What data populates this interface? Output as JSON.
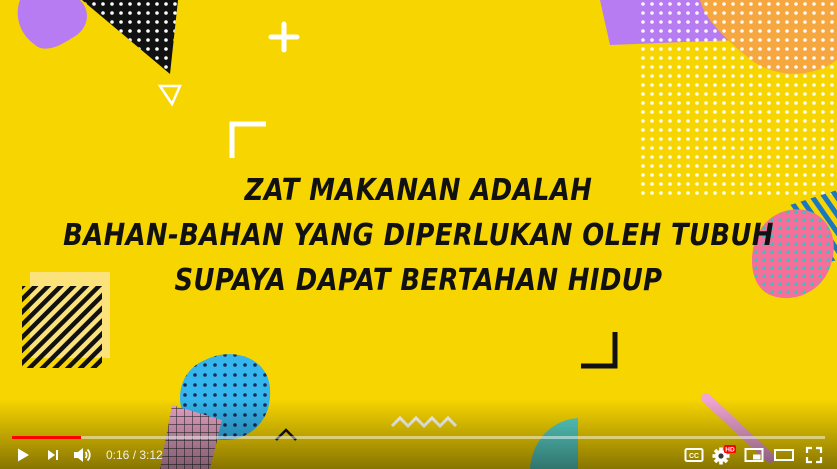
{
  "video": {
    "caption_lines": [
      "ZAT MAKANAN ADALAH",
      "BAHAN-BAHAN YANG DIPERLUKAN OLEH TUBUH",
      "SUPAYA DAPAT BERTAHAN HIDUP"
    ],
    "background_color": "#f7d500"
  },
  "player": {
    "current_time": "0:16",
    "time_separator": " / ",
    "duration": "3:12",
    "progress_fraction": 0.085,
    "progress_color": "#ff0000",
    "hd_badge": "HD",
    "icons": {
      "play": "play-icon",
      "next": "next-icon",
      "volume": "volume-icon",
      "captions": "closed-captions-icon",
      "settings": "settings-gear-icon",
      "miniplayer": "miniplayer-icon",
      "theater": "theater-mode-icon",
      "fullscreen": "fullscreen-icon"
    }
  }
}
